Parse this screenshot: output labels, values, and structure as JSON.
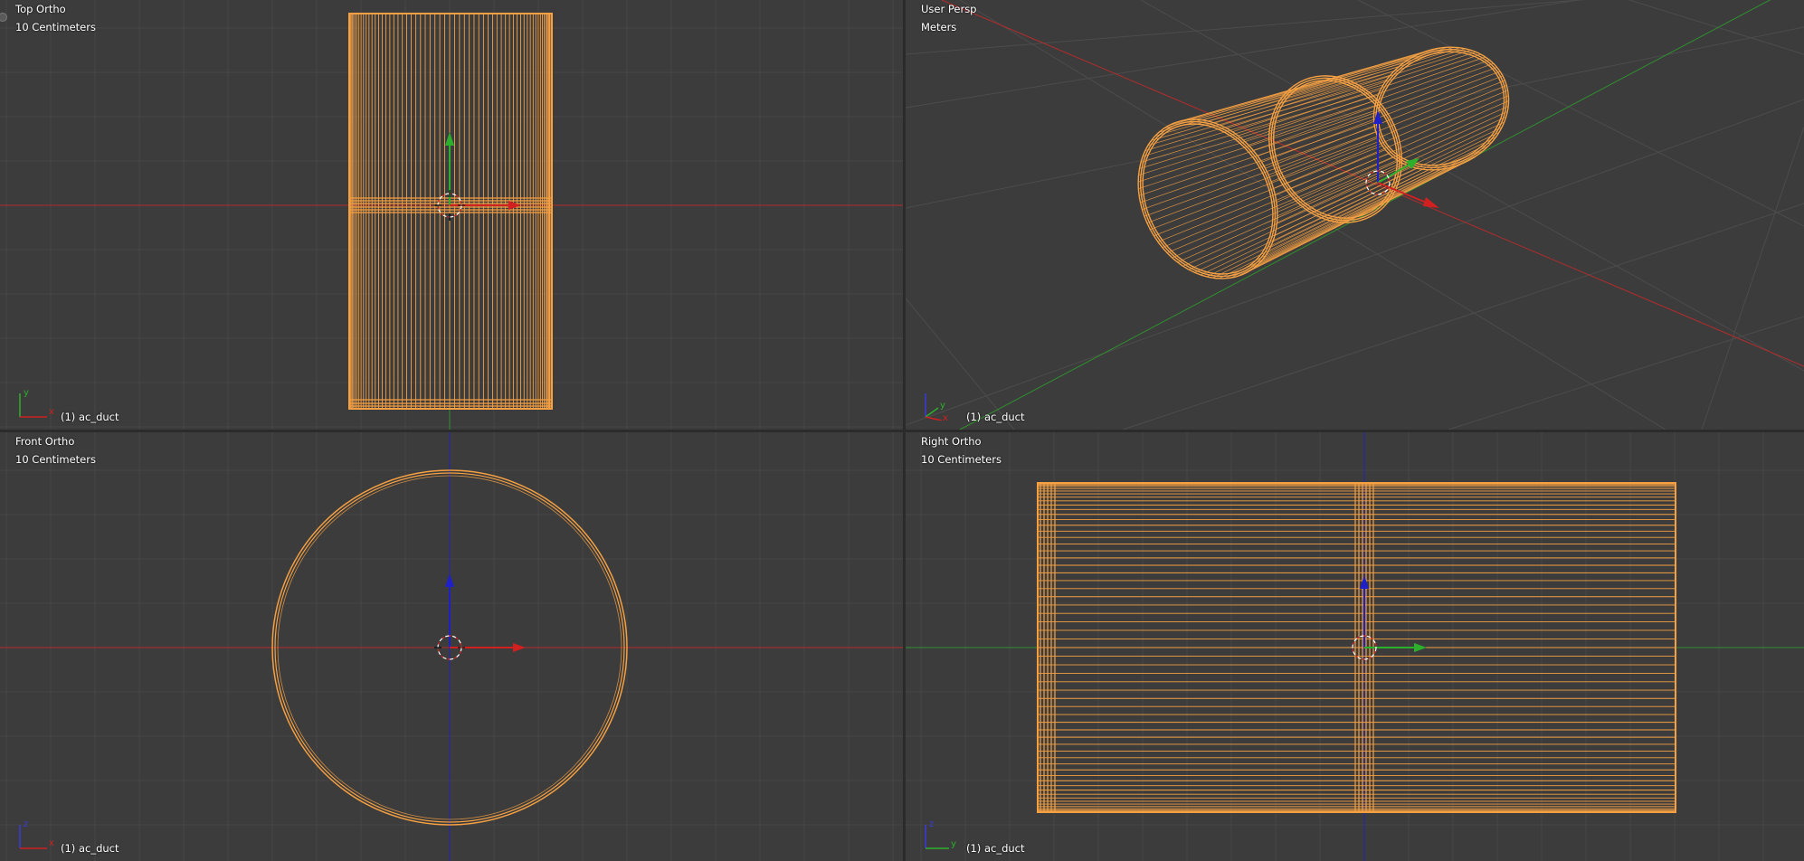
{
  "app": {
    "name": "Blender 3D Viewport (Quad View)"
  },
  "viewports": {
    "top": {
      "view_name": "Top Ortho",
      "grid_unit": "10 Centimeters",
      "object_label": "(1) ac_duct",
      "axis_a": "y",
      "axis_b": "x"
    },
    "user": {
      "view_name": "User Persp",
      "grid_unit": "Meters",
      "object_label": "(1) ac_duct",
      "axis_a": "y",
      "axis_b": "x"
    },
    "front": {
      "view_name": "Front Ortho",
      "grid_unit": "10 Centimeters",
      "object_label": "(1) ac_duct",
      "axis_a": "z",
      "axis_b": "x"
    },
    "right": {
      "view_name": "Right Ortho",
      "grid_unit": "10 Centimeters",
      "object_label": "(1) ac_duct",
      "axis_a": "z",
      "axis_b": "y"
    }
  },
  "colors": {
    "background": "#3c3c3c",
    "grid": "#444444",
    "wire": "#f5a043",
    "axis_x": "#c83232",
    "axis_y": "#3aa83a",
    "axis_z": "#3030d0",
    "text": "#ffffff"
  },
  "icons": {
    "view_corner": "area-split-corner-icon",
    "cursor": "3d-cursor-icon",
    "manipulator": "transform-manipulator-icon"
  }
}
